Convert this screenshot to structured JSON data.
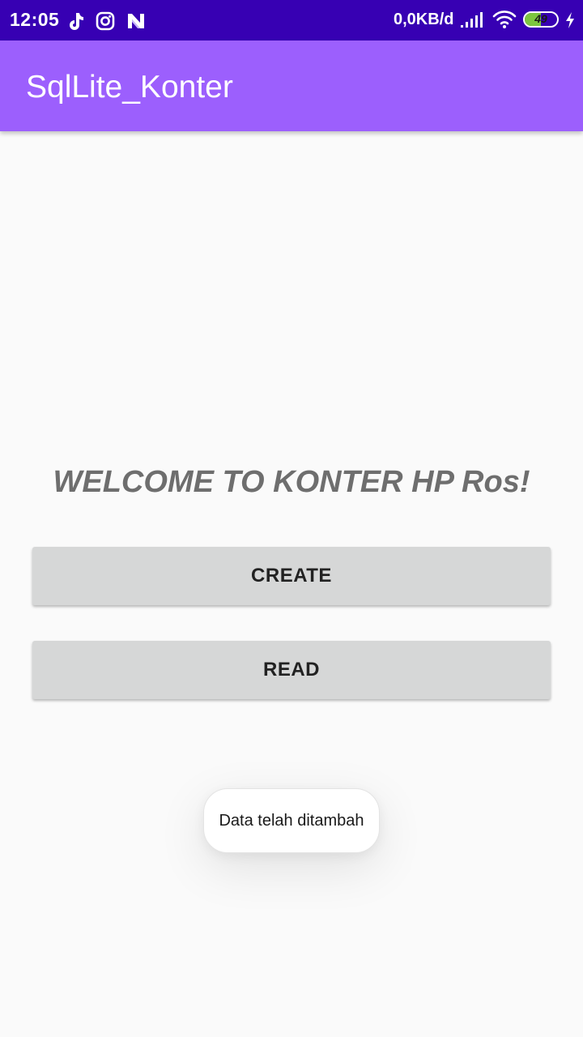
{
  "status_bar": {
    "time": "12:05",
    "network_speed": "0,0KB/d",
    "battery_level": "49",
    "battery_fraction": 0.49,
    "left_icons": [
      "tiktok-icon",
      "instagram-icon",
      "n-app-icon"
    ],
    "right_icons": [
      "signal-icon",
      "wifi-icon",
      "battery-icon",
      "charging-icon"
    ],
    "background_color": "#3700b3"
  },
  "app_bar": {
    "title": "SqlLite_Konter",
    "background_color": "#9c5ffd"
  },
  "main": {
    "welcome_text": "WELCOME TO KONTER HP Ros!",
    "create_label": "CREATE",
    "read_label": "READ"
  },
  "toast": {
    "message": "Data telah ditambah"
  }
}
